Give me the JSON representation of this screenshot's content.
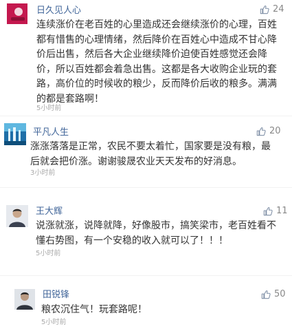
{
  "comments": [
    {
      "user": "日久见人心",
      "likes": "24",
      "text": "连续涨价在老百姓的心里造成还会继续涨价的心理，百姓都有惜售的心理情绪，然后降价在百姓心中造成不甘心降价后出售，然后各大企业继续降价迫使百姓感觉还会降价，所以百姓都会着急出售。这都是各大收购企业玩的套路，高价位的时候收的粮少，反而降价后收的粮多。满满的都是套路啊！",
      "time": "5小时前",
      "avatar_color": "#c4184e"
    },
    {
      "user": "平凡人生",
      "likes": "20",
      "text": "涨涨落落是正常，农民不要太着忙，国家要是没有粮，最后就会把价涨。谢谢骏晟农业天天发布的好消息。",
      "time": "3小时前",
      "avatar_color": "#2f8fc0"
    },
    {
      "user": "王大辉",
      "likes": "11",
      "text": "说涨就涨，说降就降，好像股市，搞笑梁市，老百姓看不懂右势图，有一个安稳的收入就可以了！！！",
      "time": "5小时前",
      "avatar_color": "#4a5060"
    },
    {
      "user": "田锐锋",
      "likes": "50",
      "text": "粮农沉住气！玩套路呢！",
      "time": "5小时前",
      "avatar_color": "#3a3f48"
    }
  ],
  "colors": {
    "username": "#406599",
    "text": "#333333",
    "meta": "#aaaaaa",
    "likes": "#888888"
  }
}
